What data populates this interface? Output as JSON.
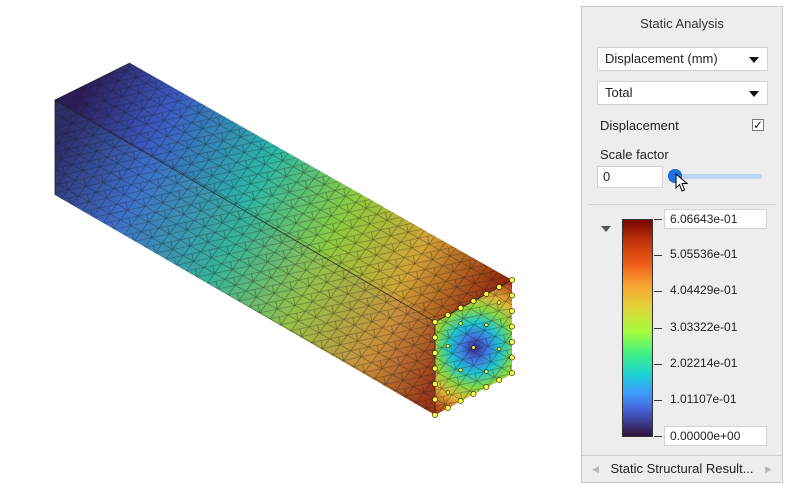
{
  "panel": {
    "title": "Static Analysis",
    "result_select": "Displacement (mm)",
    "component_select": "Total",
    "displacement_label": "Displacement",
    "displacement_checked": true,
    "scale_factor_label": "Scale factor",
    "scale_factor_value": "0",
    "scale_slider_level": 0,
    "legend_ticks": [
      "6.06643e-01",
      "5.05536e-01",
      "4.04429e-01",
      "3.03322e-01",
      "2.02214e-01",
      "1.01107e-01",
      "0.00000e+00"
    ],
    "footer_label": "Static Structural Result..."
  },
  "colormap": {
    "min": 0.0,
    "max": 0.606643,
    "colors": [
      "#30123b",
      "#4661d6",
      "#3e9cfe",
      "#1bd0d5",
      "#3ef287",
      "#a2fc3c",
      "#e3d23a",
      "#f9a231",
      "#ee5b18",
      "#c23509",
      "#7a0403"
    ]
  },
  "icons": {
    "dropdown": "chevron-down-icon",
    "collapse": "collapse-arrow-icon",
    "cursor": "mouse-cursor-icon",
    "nav_left": "chevron-left-icon",
    "nav_right": "chevron-right-icon"
  }
}
